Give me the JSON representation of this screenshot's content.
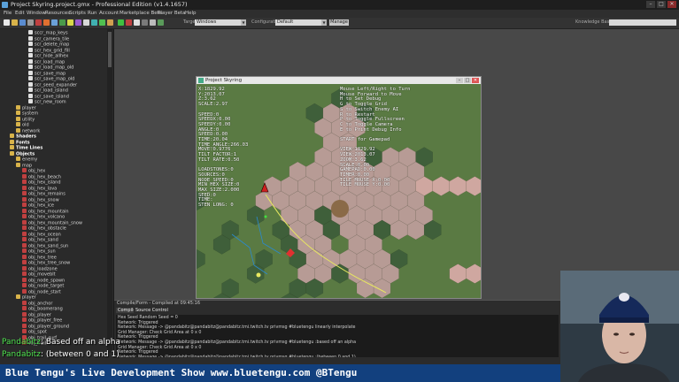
{
  "window": {
    "title": "Project Skyring.project.gmx  -  Professional Edition (v1.4.1657)",
    "controls": [
      "–",
      "□",
      "✕"
    ]
  },
  "menu": [
    "File",
    "Edit",
    "Window",
    "Resources",
    "Scripts",
    "Run",
    "Account",
    "Marketplace Beta",
    "Player Beta",
    "Help"
  ],
  "toolbar": {
    "target_label": "Target:",
    "target_value": "Windows",
    "config_label": "Configuration",
    "config_value": "Default",
    "manage_label": "Manage",
    "knowledge_label": "Knowledge Base"
  },
  "sidebar": {
    "items": [
      {
        "label": "sccr_map_keys",
        "indent": 4,
        "kind": "script"
      },
      {
        "label": "scr_camera_tile",
        "indent": 4,
        "kind": "script"
      },
      {
        "label": "scr_delete_map",
        "indent": 4,
        "kind": "script"
      },
      {
        "label": "scr_hex_grid_fill",
        "indent": 4,
        "kind": "script"
      },
      {
        "label": "scr_hide_allhex",
        "indent": 4,
        "kind": "script"
      },
      {
        "label": "scr_load_map",
        "indent": 4,
        "kind": "script"
      },
      {
        "label": "scr_load_map_old",
        "indent": 4,
        "kind": "script"
      },
      {
        "label": "scr_save_map",
        "indent": 4,
        "kind": "script"
      },
      {
        "label": "scr_save_map_old",
        "indent": 4,
        "kind": "script"
      },
      {
        "label": "scr_seed_expander",
        "indent": 4,
        "kind": "script"
      },
      {
        "label": "scr_load_island",
        "indent": 4,
        "kind": "script"
      },
      {
        "label": "scr_save_island",
        "indent": 4,
        "kind": "script"
      },
      {
        "label": "scr_new_room",
        "indent": 4,
        "kind": "script"
      },
      {
        "label": "player",
        "indent": 2,
        "kind": "folder"
      },
      {
        "label": "system",
        "indent": 2,
        "kind": "folder"
      },
      {
        "label": "utility",
        "indent": 2,
        "kind": "folder"
      },
      {
        "label": "old",
        "indent": 2,
        "kind": "folder"
      },
      {
        "label": "network",
        "indent": 2,
        "kind": "folder"
      },
      {
        "label": "Shaders",
        "indent": 1,
        "kind": "group"
      },
      {
        "label": "Fonts",
        "indent": 1,
        "kind": "group"
      },
      {
        "label": "Time Lines",
        "indent": 1,
        "kind": "group"
      },
      {
        "label": "Objects",
        "indent": 1,
        "kind": "group"
      },
      {
        "label": "enemy",
        "indent": 2,
        "kind": "folder"
      },
      {
        "label": "map",
        "indent": 2,
        "kind": "folder"
      },
      {
        "label": "obj_hex",
        "indent": 3,
        "kind": "object"
      },
      {
        "label": "obj_hex_beach",
        "indent": 3,
        "kind": "object"
      },
      {
        "label": "obj_hex_island",
        "indent": 3,
        "kind": "object"
      },
      {
        "label": "obj_hex_lava",
        "indent": 3,
        "kind": "object"
      },
      {
        "label": "obj_hex_remains",
        "indent": 3,
        "kind": "object"
      },
      {
        "label": "obj_hex_snow",
        "indent": 3,
        "kind": "object"
      },
      {
        "label": "obj_hex_ice",
        "indent": 3,
        "kind": "object"
      },
      {
        "label": "obj_hex_mountain",
        "indent": 3,
        "kind": "object"
      },
      {
        "label": "obj_hex_volcano",
        "indent": 3,
        "kind": "object"
      },
      {
        "label": "obj_hex_mountain_snow",
        "indent": 3,
        "kind": "object"
      },
      {
        "label": "obj_hex_obstacle",
        "indent": 3,
        "kind": "object"
      },
      {
        "label": "obj_hex_ocean",
        "indent": 3,
        "kind": "object"
      },
      {
        "label": "obj_hex_sand",
        "indent": 3,
        "kind": "object"
      },
      {
        "label": "obj_hex_sand_sun",
        "indent": 3,
        "kind": "object"
      },
      {
        "label": "obj_hex_sun",
        "indent": 3,
        "kind": "object"
      },
      {
        "label": "obj_hex_tree",
        "indent": 3,
        "kind": "object"
      },
      {
        "label": "obj_hex_tree_snow",
        "indent": 3,
        "kind": "object"
      },
      {
        "label": "obj_loadzone",
        "indent": 3,
        "kind": "object"
      },
      {
        "label": "obj_moveblt",
        "indent": 3,
        "kind": "object"
      },
      {
        "label": "obj_node_spawn",
        "indent": 3,
        "kind": "object"
      },
      {
        "label": "obj_node_target",
        "indent": 3,
        "kind": "object"
      },
      {
        "label": "obj_node_start",
        "indent": 3,
        "kind": "object"
      },
      {
        "label": "player",
        "indent": 2,
        "kind": "folder"
      },
      {
        "label": "obj_anchor",
        "indent": 3,
        "kind": "object"
      },
      {
        "label": "obj_boomerang",
        "indent": 3,
        "kind": "object"
      },
      {
        "label": "obj_player",
        "indent": 3,
        "kind": "object"
      },
      {
        "label": "obj_player_free",
        "indent": 3,
        "kind": "object"
      },
      {
        "label": "obj_player_ground",
        "indent": 3,
        "kind": "object"
      },
      {
        "label": "obj_spot",
        "indent": 3,
        "kind": "object"
      },
      {
        "label": "obj_trail_surf",
        "indent": 3,
        "kind": "object"
      },
      {
        "label": "obj_trail",
        "indent": 3,
        "kind": "object"
      }
    ]
  },
  "game_window": {
    "title": "Project Skyring",
    "controls": [
      "–",
      "□",
      "✕"
    ],
    "hud_left": "X:1829.92\nY:2013.07\nZ:3.62\nSCALE:2.97\n\nSPEED:0\nSPEEDX:0.00\nSPEEDY:0.00\nANGLE:0\nSPEED:0.00\nTIME:20.04\nTIME_ANGLE:266.03\nMOVE:0.9776\nTILT FACTOR:1\nTILT RATE:0.50\n\nLOADSTONES:0\nSOURCES:0\nNODE_SPEED:0\nMIN HEX SIZE:0\nMAX_SIZE:2.000\nSEED:0\nTIME:\nSTEN LONG: 0",
    "hud_right": "Mouse Left/Right to Turn\nMouse Forward to Move\nH to Set Debug\nG to Toggle Grid\nS to Switch Enemy AI\nR to Restart\nP to Toggle Fullscreen\nC to Toggle Camera\nE to Print Debug Info\n\nSTART for Gamepad\n\nVIEW:1829.92\nVIEW:2013.07\nZOOM:3.62\nSCALE:0.00\nGAMEPAD:0.00\nTIMER:0.00\nTILE MOUSE X:0.00\nTILE MOUSE Y:0.00"
  },
  "output": {
    "title": "Compile/Form - Compiled at 09:45:16",
    "tabs": [
      "Compile",
      "Source Control"
    ],
    "lines": [
      "Hex Seed Random Seed = 0",
      "Network: Triggered",
      "Network: Message -> @pandabitz@pandabitz@pandabitz.tmi.twitch.tv privmsg #bluetengu linearly interpolate",
      "Grid Manager: Check Grid Area at 0 x 0",
      "Network: Triggered",
      "Network: Message -> @pandabitz@pandabitz@pandabitz.tmi.twitch.tv privmsg #bluetengu :based off an alpha",
      "Grid Manager: Check Grid Area at 0 x 0",
      "Network: Triggered",
      "Network: Message -> @pandabitz@pandabitz@pandabitz.tmi.twitch.tv privmsg #bluetengu :(between 0 and 1)",
      "Grid Manager: Check Grid Area at 0 x 0"
    ]
  },
  "chat": [
    {
      "user": "Pandabitz",
      "text": ": Based off an alpha"
    },
    {
      "user": "Pandabitz",
      "text": ": (between 0 and 1)"
    }
  ],
  "banner": "Blue Tengu's Live Development Show   www.bluetengu.com   @BTengu",
  "colors": {
    "banner_bg": "#12407e",
    "chat_user": "#4fe34f",
    "grass": "#5a7a43",
    "hex_light": "#b79b95",
    "hex_pink": "#cfa7a0",
    "hex_dark": "#3f5f3a"
  }
}
